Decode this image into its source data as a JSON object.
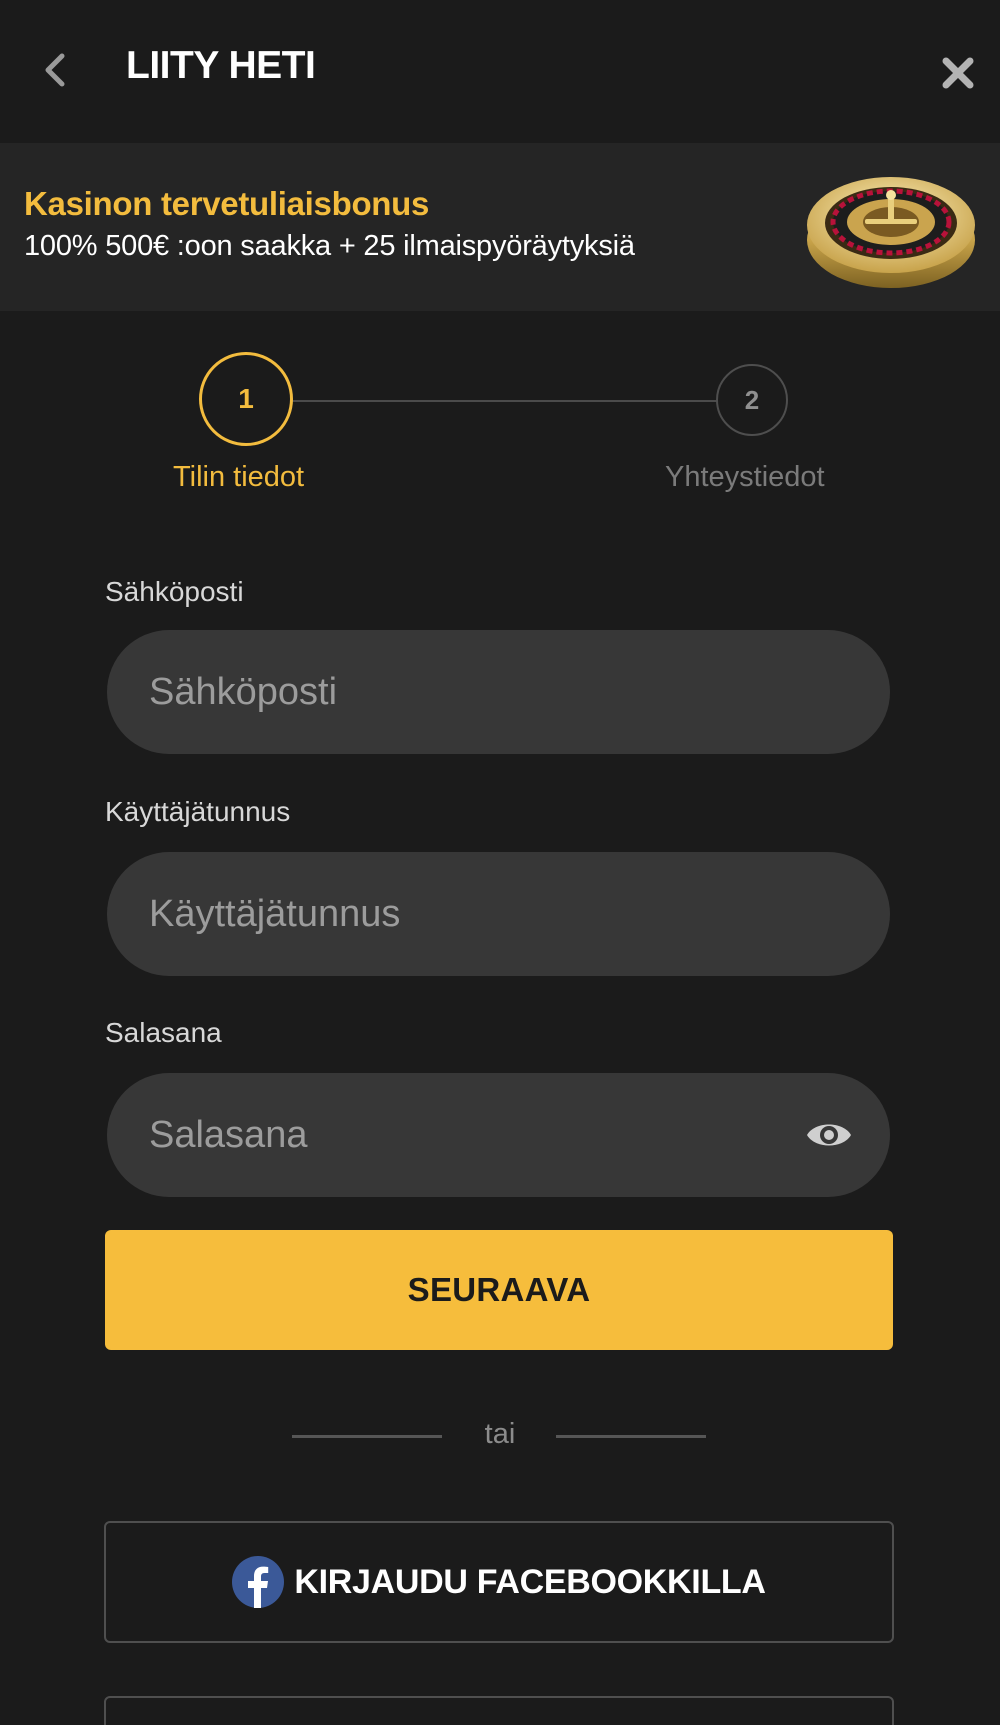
{
  "header": {
    "title": "LIITY HETI",
    "back_icon": "chevron-left-icon",
    "close_icon": "close-icon"
  },
  "bonus": {
    "title": "Kasinon tervetuliaisbonus",
    "description": "100% 500€ :oon saakka + 25 ilmaispyöräytyksiä",
    "image": "roulette-wheel"
  },
  "stepper": {
    "steps": [
      {
        "number": "1",
        "label": "Tilin tiedot",
        "active": true
      },
      {
        "number": "2",
        "label": "Yhteystiedot",
        "active": false
      }
    ]
  },
  "form": {
    "email": {
      "label": "Sähköposti",
      "placeholder": "Sähköposti",
      "value": ""
    },
    "username": {
      "label": "Käyttäjätunnus",
      "placeholder": "Käyttäjätunnus",
      "value": ""
    },
    "password": {
      "label": "Salasana",
      "placeholder": "Salasana",
      "value": "",
      "toggle_icon": "eye-icon"
    },
    "next_label": "SEURAAVA"
  },
  "divider": {
    "text": "tai"
  },
  "social": {
    "facebook_label": "KIRJAUDU FACEBOOKKILLA",
    "facebook_icon": "facebook-icon"
  },
  "colors": {
    "accent": "#f6bd3c",
    "background": "#1b1b1b",
    "banner": "#252525",
    "input": "#373737",
    "facebook": "#3b5998"
  }
}
